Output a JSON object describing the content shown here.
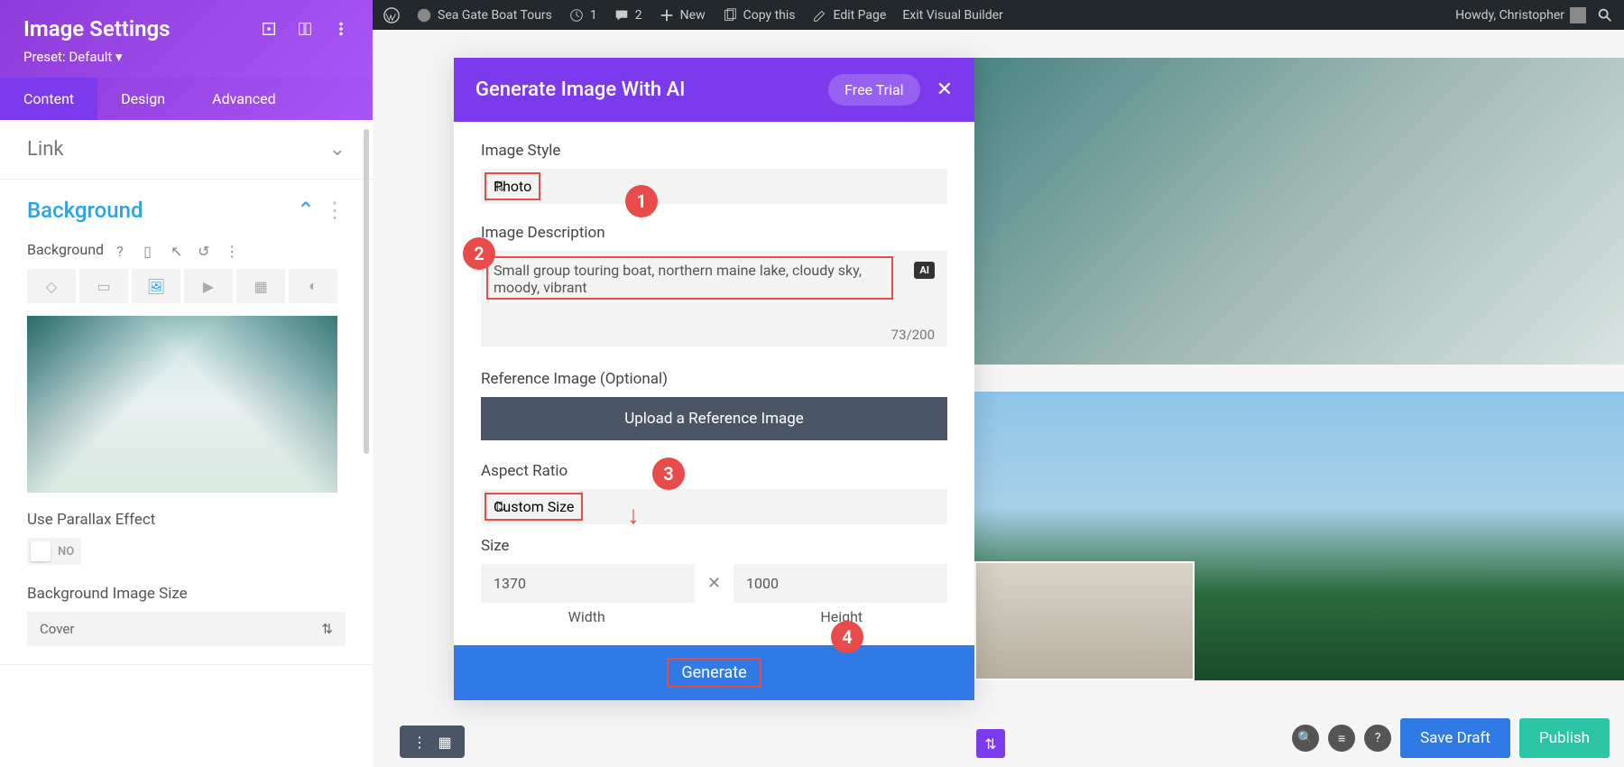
{
  "wpbar": {
    "site": "Sea Gate Boat Tours",
    "updates": "1",
    "comments": "2",
    "new": "New",
    "copy": "Copy this",
    "edit": "Edit Page",
    "exit": "Exit Visual Builder",
    "howdy": "Howdy, Christopher"
  },
  "sidebar": {
    "title": "Image Settings",
    "preset": "Preset: Default ▾",
    "tabs": {
      "content": "Content",
      "design": "Design",
      "advanced": "Advanced"
    },
    "sections": {
      "link": "Link",
      "background": "Background"
    },
    "bg": {
      "label": "Background",
      "parallax_label": "Use Parallax Effect",
      "parallax_value": "NO",
      "size_label": "Background Image Size",
      "size_value": "Cover"
    }
  },
  "modal": {
    "title": "Generate Image With AI",
    "free_trial": "Free Trial",
    "style_label": "Image Style",
    "style_value": "Photo",
    "desc_label": "Image Description",
    "desc_value": "Small group touring boat, northern maine lake, cloudy sky, moody, vibrant",
    "desc_count": "73/200",
    "ai_badge": "AI",
    "ref_label": "Reference Image (Optional)",
    "upload": "Upload a Reference Image",
    "aspect_label": "Aspect Ratio",
    "aspect_value": "Custom Size",
    "size_label": "Size",
    "width": "1370",
    "height": "1000",
    "width_label": "Width",
    "height_label": "Height",
    "generate": "Generate"
  },
  "callouts": {
    "c1": "1",
    "c2": "2",
    "c3": "3",
    "c4": "4"
  },
  "bottom": {
    "save": "Save Draft",
    "publish": "Publish"
  }
}
